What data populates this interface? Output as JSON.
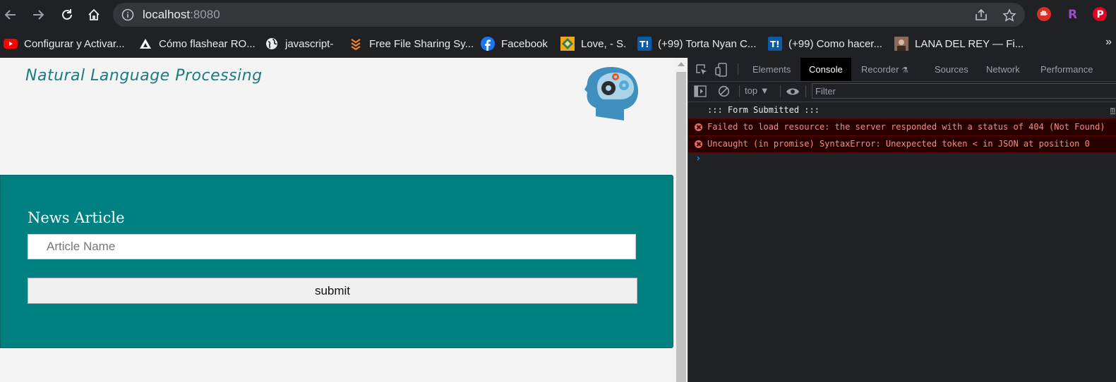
{
  "browser": {
    "url_host": "localhost",
    "url_port": ":8080"
  },
  "bookmarks": [
    {
      "label": "Configurar y Activar...",
      "icon": "youtube-icon"
    },
    {
      "label": "Cómo flashear RO...",
      "icon": "triangle-logo-icon"
    },
    {
      "label": "javascript-",
      "icon": "globe-icon"
    },
    {
      "label": "Free File Sharing Sy...",
      "icon": "layers-icon"
    },
    {
      "label": "Facebook",
      "icon": "facebook-icon"
    },
    {
      "label": "Love, - S.",
      "icon": "diamond-icon"
    },
    {
      "label": "(+99) Torta Nyan C...",
      "icon": "taringa-icon"
    },
    {
      "label": "(+99) Como hacer...",
      "icon": "taringa-icon"
    },
    {
      "label": "LANA DEL REY — Fi...",
      "icon": "photo-thumbnail-icon"
    }
  ],
  "bookmarks_more": "»",
  "page": {
    "title": "Natural Language Processing",
    "form": {
      "label": "News Article",
      "input_placeholder": "Article Name",
      "input_value": "",
      "submit_label": "submit"
    }
  },
  "devtools": {
    "tabs": [
      "Elements",
      "Console",
      "Recorder",
      "Sources",
      "Network",
      "Performance"
    ],
    "active_tab": "Console",
    "context": "top",
    "filter_placeholder": "Filter",
    "logs": [
      {
        "level": "info",
        "text": "::: Form Submitted :::",
        "source": "m"
      },
      {
        "level": "error",
        "text": "Failed to load resource: the server responded with a status of 404 (Not Found)"
      },
      {
        "level": "error",
        "text": "Uncaught (in promise) SyntaxError: Unexpected token < in JSON at position 0"
      }
    ],
    "prompt": "›"
  },
  "colors": {
    "form_background": "#008080",
    "title_color": "#1a7c80",
    "console_error": "#f28b82"
  }
}
